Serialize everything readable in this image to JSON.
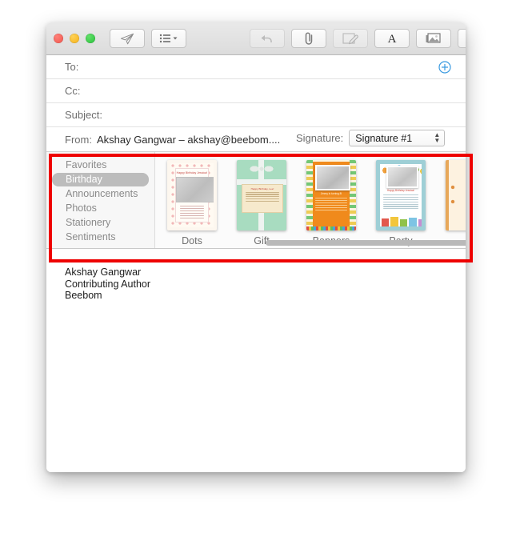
{
  "window": {
    "traffic_lights": [
      "close",
      "minimize",
      "zoom"
    ],
    "toolbar": {
      "send_label": "send-icon",
      "headers_label": "header-fields-icon",
      "undo_label": "undo-icon",
      "attach_label": "attach-icon",
      "markup_label": "markup-icon",
      "format_label": "format-icon",
      "photo_label": "photo-browser-icon",
      "stationery_label": "stationery-icon"
    }
  },
  "header": {
    "to": {
      "label": "To:",
      "value": ""
    },
    "cc": {
      "label": "Cc:",
      "value": ""
    },
    "subject": {
      "label": "Subject:",
      "value": ""
    },
    "from": {
      "label": "From:",
      "value": "Akshay Gangwar – akshay@beebom...."
    },
    "signature": {
      "label": "Signature:",
      "selected": "Signature #1"
    },
    "add_recipient_icon": "add-circle-icon"
  },
  "stationery": {
    "categories": [
      {
        "label": "Favorites",
        "selected": false
      },
      {
        "label": "Birthday",
        "selected": true
      },
      {
        "label": "Announcements",
        "selected": false
      },
      {
        "label": "Photos",
        "selected": false
      },
      {
        "label": "Stationery",
        "selected": false
      },
      {
        "label": "Sentiments",
        "selected": false
      }
    ],
    "templates": [
      {
        "label": "Dots",
        "art": "dots",
        "title": "Happy Birthday Jessica!"
      },
      {
        "label": "Gift",
        "art": "gift",
        "title": "Happy Birthday, Lee!"
      },
      {
        "label": "Banners",
        "art": "banners",
        "title": "Jimmy is turning 8!"
      },
      {
        "label": "Party",
        "art": "party",
        "title": "Happy Birthday Jessica!"
      },
      {
        "label": "",
        "art": "partial",
        "title": ""
      }
    ]
  },
  "body": {
    "signature_lines": [
      "Akshay Gangwar",
      "Contributing Author",
      "Beebom"
    ]
  },
  "annotation": {
    "highlight_color": "#ee0000"
  }
}
